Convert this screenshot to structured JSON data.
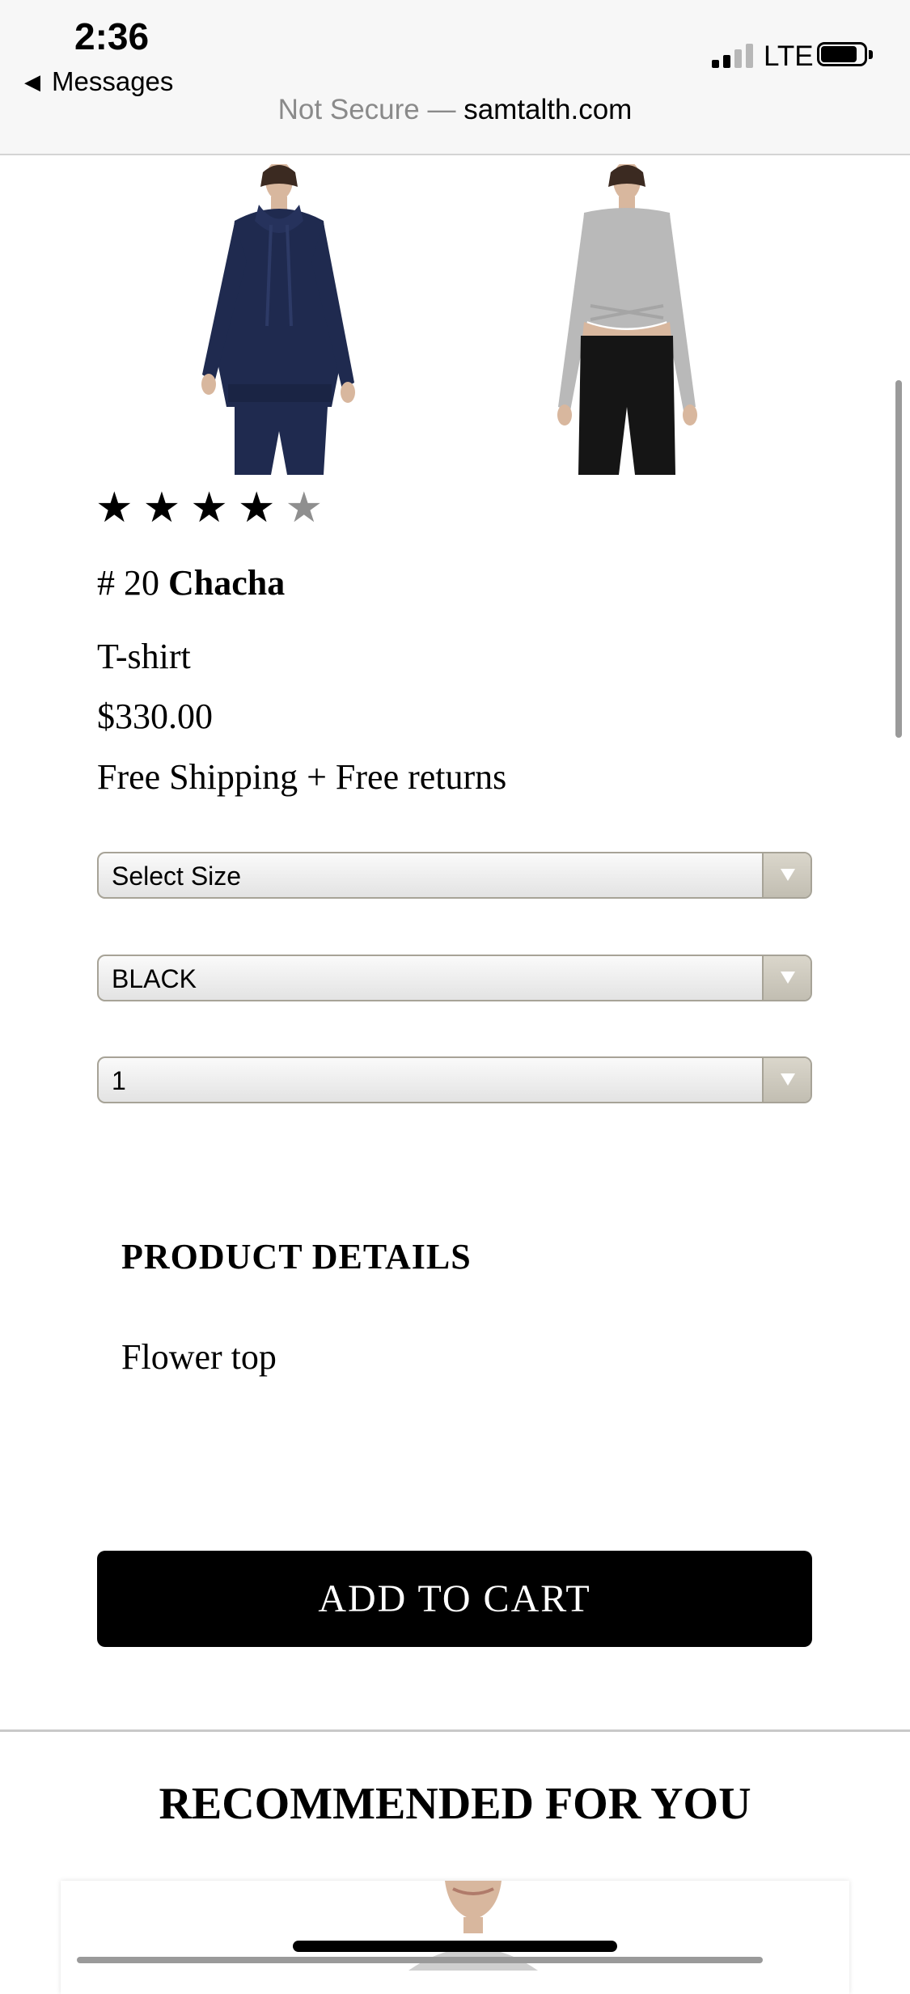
{
  "status_bar": {
    "time": "2:36",
    "back_label": "Messages",
    "network": "LTE"
  },
  "url_bar": {
    "security": "Not Secure —",
    "domain": "samtalth.com"
  },
  "product": {
    "rating": 4,
    "rating_max": 5,
    "number": "# 20",
    "name": "Chacha",
    "type": "T-shirt",
    "price": "$330.00",
    "shipping": "Free Shipping + Free returns",
    "size_select": "Select Size",
    "color_select": "BLACK",
    "quantity_select": "1",
    "details_title": "PRODUCT DETAILS",
    "details_text": "Flower top",
    "add_to_cart": "ADD TO CART"
  },
  "recommended": {
    "title": "RECOMMENDED FOR YOU"
  },
  "colors": {
    "accent": "#000000",
    "star_off": "#8f8f8f"
  }
}
